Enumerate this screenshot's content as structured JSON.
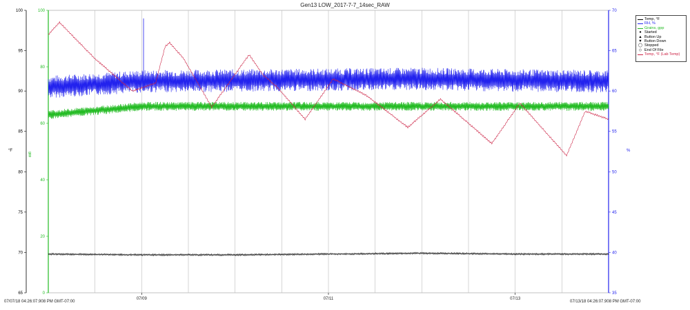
{
  "chart_data": {
    "type": "line",
    "title": "Gen13 LOW_2017-7-7_14sec_RAW",
    "x_range_label_start": "07/07/18 04:26:07.908 PM GMT-07:00",
    "x_range_label_end": "07/13/18 04:26:07.908 PM GMT-07:00",
    "x_ticks": [
      "07/09",
      "07/11",
      "07/13"
    ],
    "grid": true,
    "legend_position": "right",
    "axes": {
      "temp_f": {
        "label": "°F",
        "ylim": [
          65,
          100
        ],
        "ticks": [
          65,
          70,
          75,
          80,
          85,
          90,
          95,
          100
        ],
        "color": "#000000"
      },
      "grains_gpp": {
        "label": "gpp",
        "ylim": [
          0,
          100
        ],
        "ticks": [
          0,
          20,
          40,
          60,
          80,
          100
        ],
        "color": "#22bb22"
      },
      "rh_pct": {
        "label": "%",
        "ylim": [
          35,
          70
        ],
        "ticks": [
          35,
          40,
          45,
          50,
          55,
          60,
          65,
          70
        ],
        "color": "#2222ee"
      }
    },
    "series": [
      {
        "name": "Temp, °F",
        "color": "#000000",
        "axis": "temp_f",
        "note_value": 69.8,
        "x_days": [
          0,
          1,
          2,
          3,
          4,
          5,
          6
        ],
        "values": [
          69.8,
          69.7,
          69.7,
          69.8,
          69.9,
          69.8,
          69.8
        ]
      },
      {
        "name": "RH, %",
        "color": "#2222ee",
        "axis": "rh_pct",
        "x_days": [
          0,
          1,
          2,
          3,
          4,
          5,
          6
        ],
        "values": [
          60.5,
          61.2,
          61.3,
          61.4,
          61.5,
          61.3,
          61.2
        ]
      },
      {
        "name": "Grains, gpp",
        "color": "#22bb22",
        "axis": "grains_gpp",
        "x_days": [
          0,
          1,
          2,
          3,
          4,
          5,
          6
        ],
        "values": [
          63,
          66,
          66,
          66,
          66,
          66,
          66
        ]
      },
      {
        "name": "Temp, °F (Lab Temp)",
        "color": "#cc2244",
        "axis": "temp_f",
        "x_days": [
          0,
          0.12,
          0.5,
          0.9,
          1.15,
          1.25,
          1.3,
          1.45,
          1.75,
          2.15,
          2.3,
          2.45,
          2.75,
          3.05,
          3.4,
          3.85,
          4.2,
          4.75,
          5.05,
          5.55,
          5.75,
          6.0
        ],
        "values": [
          97,
          98.5,
          94,
          90,
          91,
          95.5,
          96,
          94,
          88,
          94.5,
          92,
          90.5,
          86.5,
          91.5,
          89.5,
          85.5,
          89,
          83.5,
          88.5,
          82,
          87.5,
          86.5
        ]
      }
    ],
    "legend_markers": [
      {
        "label": "Started",
        "glyph": "●"
      },
      {
        "label": "Button Up",
        "glyph": "▲"
      },
      {
        "label": "Button Down",
        "glyph": "▼"
      },
      {
        "label": "Stopped",
        "glyph": "◯"
      },
      {
        "label": "End Of File",
        "glyph": "◇"
      }
    ]
  }
}
